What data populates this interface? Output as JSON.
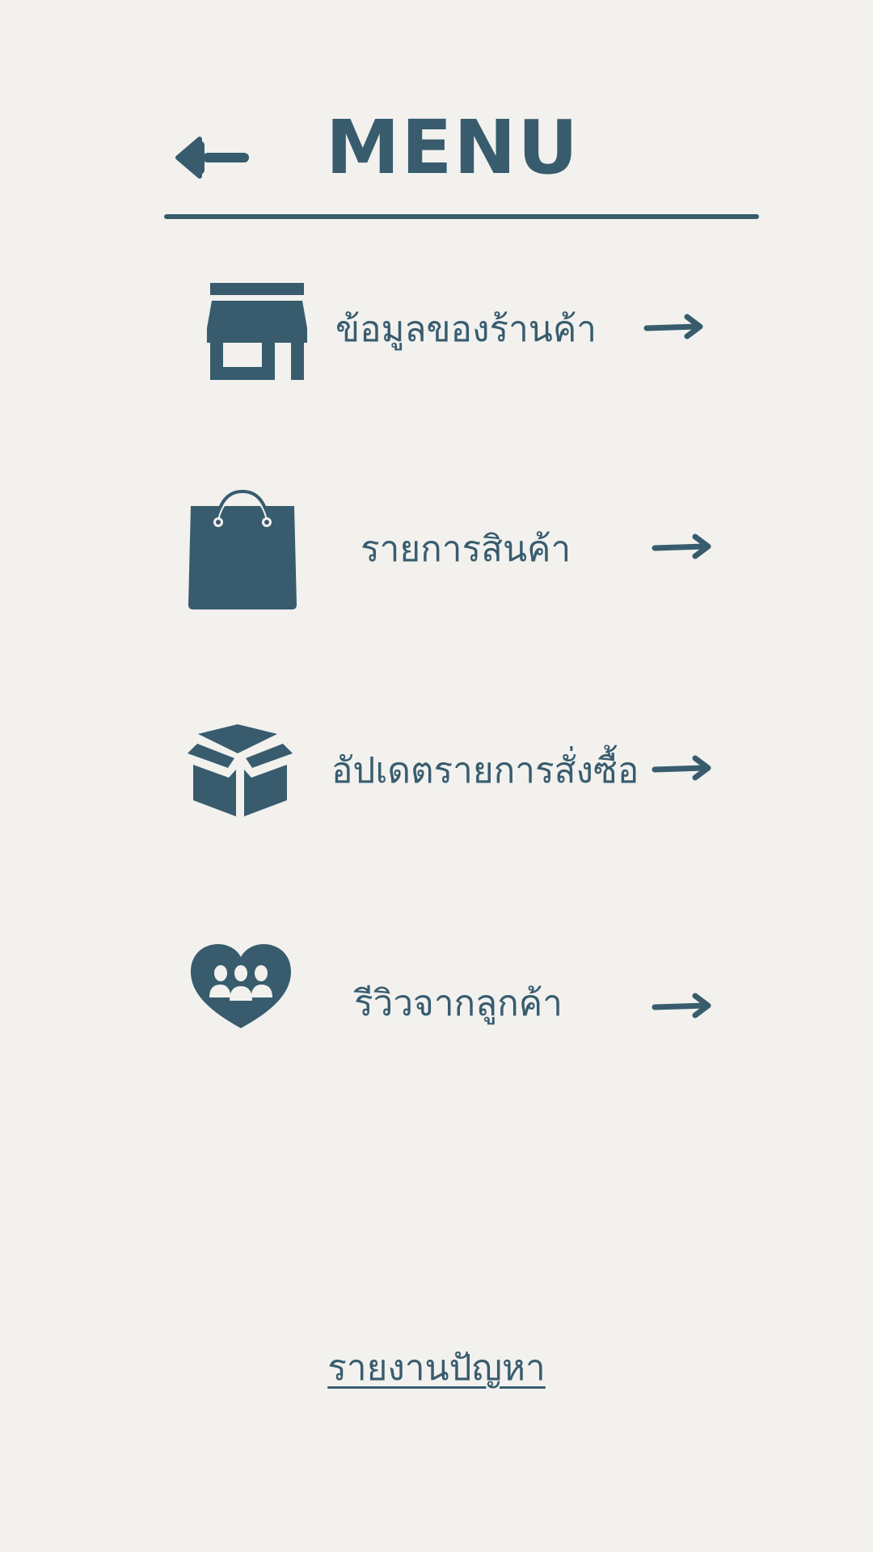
{
  "header": {
    "title": "MENU",
    "back_icon": "back-arrow-icon"
  },
  "menu": {
    "items": [
      {
        "label": "ข้อมูลของร้านค้า",
        "icon": "storefront-icon",
        "arrow_icon": "arrow-right-icon"
      },
      {
        "label": "รายการสินค้า",
        "icon": "shopping-bag-icon",
        "arrow_icon": "arrow-right-icon"
      },
      {
        "label": "อัปเดตรายการสั่งซื้อ",
        "icon": "open-box-icon",
        "arrow_icon": "arrow-right-icon"
      },
      {
        "label": "รีวิวจากลูกค้า",
        "icon": "heart-people-icon",
        "arrow_icon": "arrow-right-icon"
      }
    ]
  },
  "footer": {
    "report_label": "รายงานปัญหา"
  },
  "colors": {
    "background": "#f2f1ee",
    "accent": "#385c6e"
  }
}
